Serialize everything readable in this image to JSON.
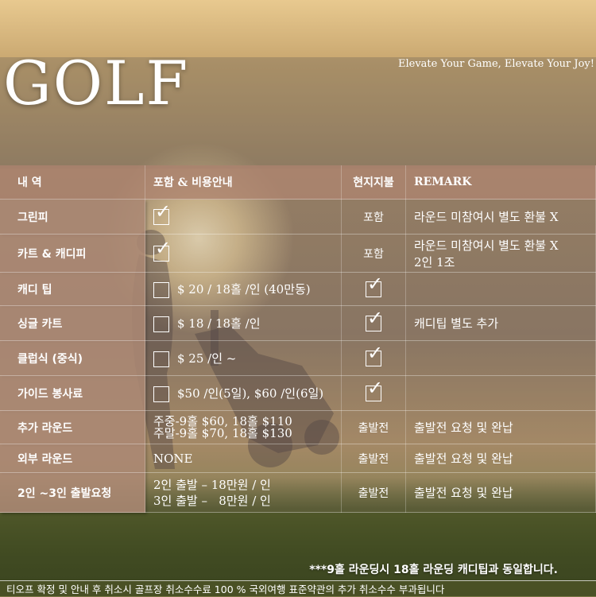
{
  "title": "GOLF",
  "tagline": "Elevate Your Game, Elevate Your Joy!",
  "table": {
    "headers": [
      "내    역",
      "포함 & 비용안내",
      "현지지불",
      "REMARK"
    ],
    "rows": [
      {
        "label": "그린피",
        "checked": true,
        "cost": "",
        "local": "포함",
        "local_checked": false,
        "remark": [
          "라운드 미참여시 별도 환불 X"
        ]
      },
      {
        "label": "카트 & 캐디피",
        "checked": true,
        "cost": "",
        "local": "포함",
        "local_checked": false,
        "remark": [
          "라운드 미참여시 별도 환불 X",
          "2인 1조"
        ]
      },
      {
        "label": "캐디 팁",
        "checked": false,
        "cost": "$ 20 / 18홀 /인 (40만동)",
        "local": "",
        "local_checked": true,
        "remark": []
      },
      {
        "label": "싱글 카트",
        "checked": false,
        "cost": "$ 18 / 18홀 /인",
        "local": "",
        "local_checked": true,
        "remark": [
          "캐디팁 별도 추가"
        ]
      },
      {
        "label": "클럽식 (중식)",
        "checked": false,
        "cost": "$ 25 /인 ~",
        "local": "",
        "local_checked": true,
        "remark": []
      },
      {
        "label": "가이드 봉사료",
        "checked": false,
        "cost": "$50 /인(5일), $60 /인(6일)",
        "local": "",
        "local_checked": true,
        "remark": []
      }
    ],
    "extra_round": {
      "label": "추가 라운드",
      "lines": [
        "주중-9홀 $60, 18홀 $110",
        "주말-9홀 $70, 18홀 $130"
      ],
      "local": "출발전",
      "remark": "출발전 요청 및 완납"
    },
    "outside_round": {
      "label": "외부 라운드",
      "value": "NONE",
      "local": "출발전",
      "remark": "출발전 요청 및 완납"
    },
    "small_group": {
      "label": "2인 ~3인 출발요청",
      "lines": [
        "2인 출발 – 18만원 / 인",
        "3인 출발 –   8만원 / 인"
      ],
      "local": "출발전",
      "remark": "출발전 요청 및 완납"
    }
  },
  "footnote": "***9홀 라운딩시 18홀 라운딩 캐디팁과 동일합니다.",
  "bottom_notice": "티오프 확정 및 안내 후 취소시 골프장 취소수수료 100 % 국외여행 표준약관의 추가 취소수수 부과됩니다"
}
